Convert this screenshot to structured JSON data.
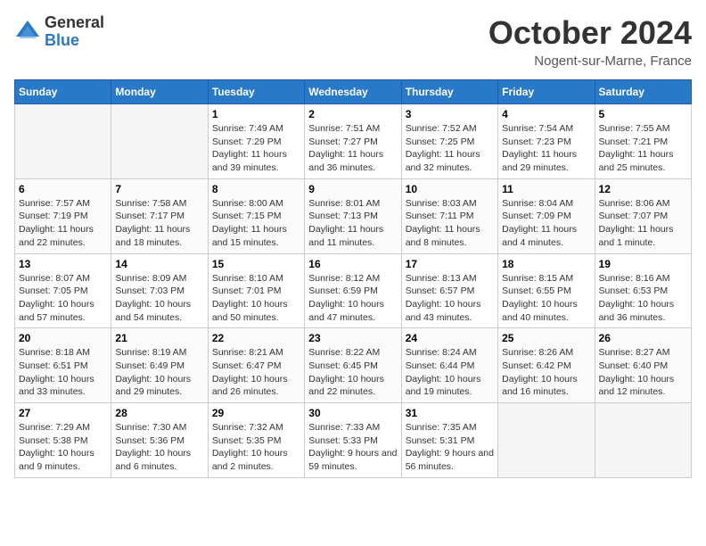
{
  "header": {
    "logo_general": "General",
    "logo_blue": "Blue",
    "month_title": "October 2024",
    "location": "Nogent-sur-Marne, France"
  },
  "days_of_week": [
    "Sunday",
    "Monday",
    "Tuesday",
    "Wednesday",
    "Thursday",
    "Friday",
    "Saturday"
  ],
  "weeks": [
    [
      {
        "day": "",
        "empty": true
      },
      {
        "day": "",
        "empty": true
      },
      {
        "day": "1",
        "sunrise": "Sunrise: 7:49 AM",
        "sunset": "Sunset: 7:29 PM",
        "daylight": "Daylight: 11 hours and 39 minutes."
      },
      {
        "day": "2",
        "sunrise": "Sunrise: 7:51 AM",
        "sunset": "Sunset: 7:27 PM",
        "daylight": "Daylight: 11 hours and 36 minutes."
      },
      {
        "day": "3",
        "sunrise": "Sunrise: 7:52 AM",
        "sunset": "Sunset: 7:25 PM",
        "daylight": "Daylight: 11 hours and 32 minutes."
      },
      {
        "day": "4",
        "sunrise": "Sunrise: 7:54 AM",
        "sunset": "Sunset: 7:23 PM",
        "daylight": "Daylight: 11 hours and 29 minutes."
      },
      {
        "day": "5",
        "sunrise": "Sunrise: 7:55 AM",
        "sunset": "Sunset: 7:21 PM",
        "daylight": "Daylight: 11 hours and 25 minutes."
      }
    ],
    [
      {
        "day": "6",
        "sunrise": "Sunrise: 7:57 AM",
        "sunset": "Sunset: 7:19 PM",
        "daylight": "Daylight: 11 hours and 22 minutes."
      },
      {
        "day": "7",
        "sunrise": "Sunrise: 7:58 AM",
        "sunset": "Sunset: 7:17 PM",
        "daylight": "Daylight: 11 hours and 18 minutes."
      },
      {
        "day": "8",
        "sunrise": "Sunrise: 8:00 AM",
        "sunset": "Sunset: 7:15 PM",
        "daylight": "Daylight: 11 hours and 15 minutes."
      },
      {
        "day": "9",
        "sunrise": "Sunrise: 8:01 AM",
        "sunset": "Sunset: 7:13 PM",
        "daylight": "Daylight: 11 hours and 11 minutes."
      },
      {
        "day": "10",
        "sunrise": "Sunrise: 8:03 AM",
        "sunset": "Sunset: 7:11 PM",
        "daylight": "Daylight: 11 hours and 8 minutes."
      },
      {
        "day": "11",
        "sunrise": "Sunrise: 8:04 AM",
        "sunset": "Sunset: 7:09 PM",
        "daylight": "Daylight: 11 hours and 4 minutes."
      },
      {
        "day": "12",
        "sunrise": "Sunrise: 8:06 AM",
        "sunset": "Sunset: 7:07 PM",
        "daylight": "Daylight: 11 hours and 1 minute."
      }
    ],
    [
      {
        "day": "13",
        "sunrise": "Sunrise: 8:07 AM",
        "sunset": "Sunset: 7:05 PM",
        "daylight": "Daylight: 10 hours and 57 minutes."
      },
      {
        "day": "14",
        "sunrise": "Sunrise: 8:09 AM",
        "sunset": "Sunset: 7:03 PM",
        "daylight": "Daylight: 10 hours and 54 minutes."
      },
      {
        "day": "15",
        "sunrise": "Sunrise: 8:10 AM",
        "sunset": "Sunset: 7:01 PM",
        "daylight": "Daylight: 10 hours and 50 minutes."
      },
      {
        "day": "16",
        "sunrise": "Sunrise: 8:12 AM",
        "sunset": "Sunset: 6:59 PM",
        "daylight": "Daylight: 10 hours and 47 minutes."
      },
      {
        "day": "17",
        "sunrise": "Sunrise: 8:13 AM",
        "sunset": "Sunset: 6:57 PM",
        "daylight": "Daylight: 10 hours and 43 minutes."
      },
      {
        "day": "18",
        "sunrise": "Sunrise: 8:15 AM",
        "sunset": "Sunset: 6:55 PM",
        "daylight": "Daylight: 10 hours and 40 minutes."
      },
      {
        "day": "19",
        "sunrise": "Sunrise: 8:16 AM",
        "sunset": "Sunset: 6:53 PM",
        "daylight": "Daylight: 10 hours and 36 minutes."
      }
    ],
    [
      {
        "day": "20",
        "sunrise": "Sunrise: 8:18 AM",
        "sunset": "Sunset: 6:51 PM",
        "daylight": "Daylight: 10 hours and 33 minutes."
      },
      {
        "day": "21",
        "sunrise": "Sunrise: 8:19 AM",
        "sunset": "Sunset: 6:49 PM",
        "daylight": "Daylight: 10 hours and 29 minutes."
      },
      {
        "day": "22",
        "sunrise": "Sunrise: 8:21 AM",
        "sunset": "Sunset: 6:47 PM",
        "daylight": "Daylight: 10 hours and 26 minutes."
      },
      {
        "day": "23",
        "sunrise": "Sunrise: 8:22 AM",
        "sunset": "Sunset: 6:45 PM",
        "daylight": "Daylight: 10 hours and 22 minutes."
      },
      {
        "day": "24",
        "sunrise": "Sunrise: 8:24 AM",
        "sunset": "Sunset: 6:44 PM",
        "daylight": "Daylight: 10 hours and 19 minutes."
      },
      {
        "day": "25",
        "sunrise": "Sunrise: 8:26 AM",
        "sunset": "Sunset: 6:42 PM",
        "daylight": "Daylight: 10 hours and 16 minutes."
      },
      {
        "day": "26",
        "sunrise": "Sunrise: 8:27 AM",
        "sunset": "Sunset: 6:40 PM",
        "daylight": "Daylight: 10 hours and 12 minutes."
      }
    ],
    [
      {
        "day": "27",
        "sunrise": "Sunrise: 7:29 AM",
        "sunset": "Sunset: 5:38 PM",
        "daylight": "Daylight: 10 hours and 9 minutes."
      },
      {
        "day": "28",
        "sunrise": "Sunrise: 7:30 AM",
        "sunset": "Sunset: 5:36 PM",
        "daylight": "Daylight: 10 hours and 6 minutes."
      },
      {
        "day": "29",
        "sunrise": "Sunrise: 7:32 AM",
        "sunset": "Sunset: 5:35 PM",
        "daylight": "Daylight: 10 hours and 2 minutes."
      },
      {
        "day": "30",
        "sunrise": "Sunrise: 7:33 AM",
        "sunset": "Sunset: 5:33 PM",
        "daylight": "Daylight: 9 hours and 59 minutes."
      },
      {
        "day": "31",
        "sunrise": "Sunrise: 7:35 AM",
        "sunset": "Sunset: 5:31 PM",
        "daylight": "Daylight: 9 hours and 56 minutes."
      },
      {
        "day": "",
        "empty": true
      },
      {
        "day": "",
        "empty": true
      }
    ]
  ]
}
